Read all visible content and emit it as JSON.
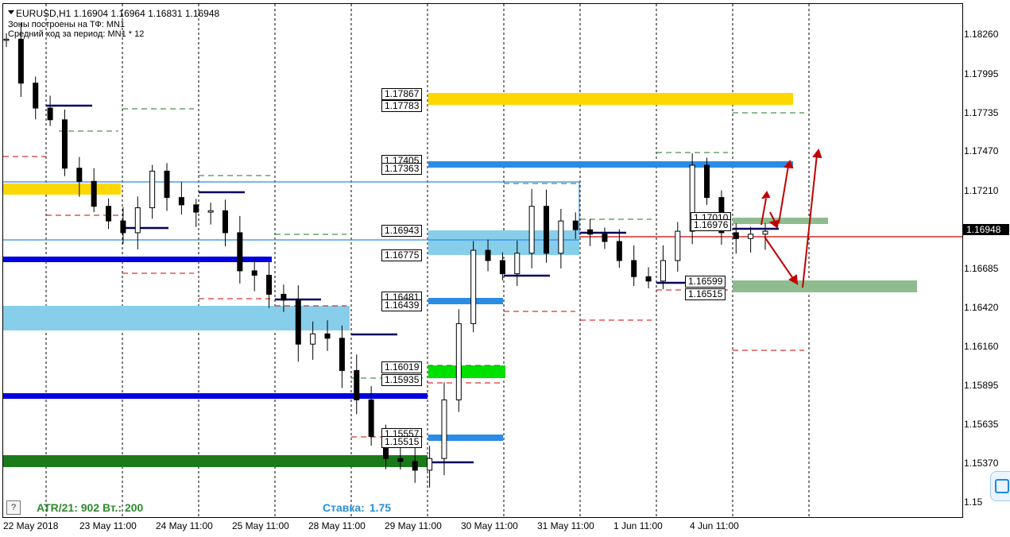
{
  "header": {
    "symbol": "EURUSD,H1  1.16904 1.16964 1.16831 1.16948",
    "zones_tf": "Зоны построены на ТФ: MN1",
    "avg_range": "Средний ход за период: MN1 * 12"
  },
  "price_axis": {
    "ticks": [
      "1.18260",
      "1.17995",
      "1.17735",
      "1.17470",
      "1.17210",
      "1.16948",
      "1.16685",
      "1.16420",
      "1.16160",
      "1.15895",
      "1.15635",
      "1.15370",
      "1.15"
    ],
    "current_price": "1.16948"
  },
  "time_axis": [
    "22 May 2018",
    "23 May 11:00",
    "24 May 11:00",
    "25 May 11:00",
    "28 May 11:00",
    "29 May 11:00",
    "30 May 11:00",
    "31 May 11:00",
    "1 Jun 11:00",
    "4 Jun 11:00"
  ],
  "level_labels": {
    "l1": "1.17867",
    "l2": "1.17783",
    "l3": "1.17405",
    "l4": "1.17363",
    "l5": "1.16943",
    "l6": "1.16775",
    "l7": "1.16481",
    "l8": "1.16439",
    "l9": "1.16019",
    "l10": "1.15935",
    "l11": "1.15557",
    "l12": "1.15515",
    "l13": "1.17010",
    "l14": "1.16976",
    "l15": "1.16599",
    "l16": "1.16515"
  },
  "footer": {
    "help": "?",
    "atr": "ATR/21: 902  Вт.: 200",
    "rate_label": "Ставка:",
    "rate_value": "1.75"
  },
  "colors": {
    "zone_yellow": "#ffd700",
    "zone_blue": "#2b8ce6",
    "zone_lightblue": "#87ceeb",
    "zone_green_bright": "#00e000",
    "zone_green_dark": "#1a7a1a",
    "zone_green_soft": "#8fbc8f",
    "level_navy": "#0000e0",
    "arrow_red": "#c00000"
  },
  "chart_data": {
    "type": "candlestick",
    "symbol": "EURUSD",
    "timeframe": "H1",
    "x": [
      "22 May 2018",
      "23 May 11:00",
      "24 May 11:00",
      "25 May 11:00",
      "28 May 11:00",
      "29 May 11:00",
      "30 May 11:00",
      "31 May 11:00",
      "1 Jun 11:00",
      "4 Jun 11:00"
    ],
    "close_path": [
      1.1826,
      1.1796,
      1.1779,
      1.1771,
      1.1738,
      1.1729,
      1.1712,
      1.1702,
      1.1694,
      1.1711,
      1.1736,
      1.1718,
      1.1713,
      1.1708,
      1.1709,
      1.1694,
      1.1668,
      1.1665,
      1.1652,
      1.1648,
      1.1618,
      1.1625,
      1.1622,
      1.16,
      1.158,
      1.1555,
      1.154,
      1.1538,
      1.1532,
      1.154,
      1.158,
      1.1632,
      1.1682,
      1.1675,
      1.1666,
      1.168,
      1.1712,
      1.168,
      1.1702,
      1.1696,
      1.1693,
      1.1688,
      1.1675,
      1.1664,
      1.1661,
      1.1675,
      1.1695,
      1.174,
      1.1718,
      1.1694,
      1.169,
      1.1693,
      1.1695
    ],
    "ylim": [
      1.15,
      1.185
    ]
  }
}
